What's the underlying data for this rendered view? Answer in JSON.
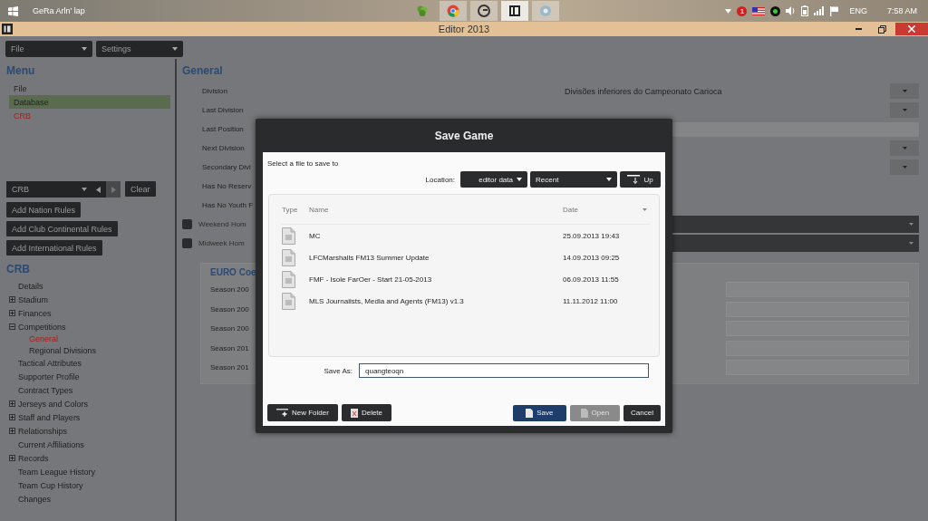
{
  "taskbar": {
    "title": "GeRa Arln' lap",
    "apps": [
      {
        "kind": "leaf",
        "selected": false
      },
      {
        "kind": "browser",
        "selected": false
      },
      {
        "kind": "letter",
        "selected": false
      },
      {
        "kind": "editor",
        "selected": true
      },
      {
        "kind": "disc",
        "selected": false
      }
    ],
    "badge": "1",
    "language": "ENG",
    "time": "7:58 AM"
  },
  "window": {
    "title": "Editor 2013"
  },
  "toolbar": [
    {
      "label": "File"
    },
    {
      "label": "Settings"
    }
  ],
  "sidebar": {
    "menu_title": "Menu",
    "menu_items": [
      {
        "label": "File",
        "selected": false,
        "current": false
      },
      {
        "label": "Database",
        "selected": true,
        "current": false
      },
      {
        "label": "CRB",
        "selected": false,
        "current": true
      }
    ],
    "picker": {
      "value": "CRB",
      "clear": "Clear"
    },
    "rule_buttons": [
      "Add Nation Rules",
      "Add Club Continental Rules",
      "Add International Rules"
    ],
    "tree_title": "CRB",
    "tree": [
      {
        "label": "Details",
        "kind": "leaf",
        "current": false
      },
      {
        "label": "Stadium",
        "kind": "branch",
        "expanded": false,
        "current": false
      },
      {
        "label": "Finances",
        "kind": "branch",
        "expanded": false,
        "current": false
      },
      {
        "label": "Competitions",
        "kind": "branch",
        "expanded": true,
        "current": false,
        "children": [
          {
            "label": "General",
            "current": true
          },
          {
            "label": "Regional Divisions",
            "current": false
          }
        ]
      },
      {
        "label": "Tactical Attributes",
        "kind": "leaf",
        "current": false
      },
      {
        "label": "Supporter Profile",
        "kind": "leaf",
        "current": false
      },
      {
        "label": "Contract Types",
        "kind": "leaf",
        "current": false
      },
      {
        "label": "Jerseys and Colors",
        "kind": "branch",
        "expanded": false,
        "current": false
      },
      {
        "label": "Staff and Players",
        "kind": "branch",
        "expanded": false,
        "current": false
      },
      {
        "label": "Relationships",
        "kind": "branch",
        "expanded": false,
        "current": false
      },
      {
        "label": "Current Affiliations",
        "kind": "leaf",
        "current": false
      },
      {
        "label": "Records",
        "kind": "branch",
        "expanded": false,
        "current": false
      },
      {
        "label": "Team League History",
        "kind": "leaf",
        "current": false
      },
      {
        "label": "Team Cup History",
        "kind": "leaf",
        "current": false
      },
      {
        "label": "Changes",
        "kind": "leaf",
        "current": false
      }
    ]
  },
  "main": {
    "title": "General",
    "fields": [
      {
        "label": "Division",
        "value": "Divisões inferiores do Campeonato Carioca",
        "kind": "dropdown"
      },
      {
        "label": "Last Division",
        "kind": "dropdown"
      },
      {
        "label": "Last Position",
        "kind": "text"
      },
      {
        "label": "Next Division",
        "kind": "dropdown"
      },
      {
        "label": "Secondary Divi",
        "kind": "dropdown"
      },
      {
        "label": "Has No Reserv",
        "kind": "none"
      },
      {
        "label": "Has No Youth F",
        "kind": "none"
      }
    ],
    "options": [
      {
        "label": "Weekend Hom",
        "checked": false
      },
      {
        "label": "Midweek Hom",
        "checked": false
      }
    ],
    "panel": {
      "title": "EURO Coe",
      "rows": [
        "Season 200",
        "Season 200",
        "Season 200",
        "Season 201",
        "Season 201"
      ]
    }
  },
  "dialog": {
    "title": "Save Game",
    "prompt": "Select a file to save to",
    "location_label": "Location:",
    "location": "editor data",
    "filter": "Recent",
    "up": "Up",
    "columns": [
      "Type",
      "Name",
      "Date"
    ],
    "files": [
      {
        "name": "MC",
        "date": "25.09.2013 19:43"
      },
      {
        "name": "LFCMarshalls FM13 Summer Update",
        "date": "14.09.2013 09:25"
      },
      {
        "name": "FMF - Isole FarOer - Start 21-05-2013",
        "date": "06.09.2013 11:55"
      },
      {
        "name": "MLS Journalists, Media and Agents (FM13) v1.3",
        "date": "11.11.2012 11:00"
      }
    ],
    "save_as_label": "Save As:",
    "save_as": "quangteoqn",
    "tools": [
      {
        "label": "New Folder",
        "kind": "new-folder"
      },
      {
        "label": "Delete",
        "kind": "delete"
      }
    ],
    "actions": [
      {
        "label": "Save",
        "kind": "primary",
        "disabled": false
      },
      {
        "label": "Open",
        "kind": "plain",
        "disabled": true
      },
      {
        "label": "Cancel",
        "kind": "plain",
        "disabled": false
      }
    ]
  }
}
